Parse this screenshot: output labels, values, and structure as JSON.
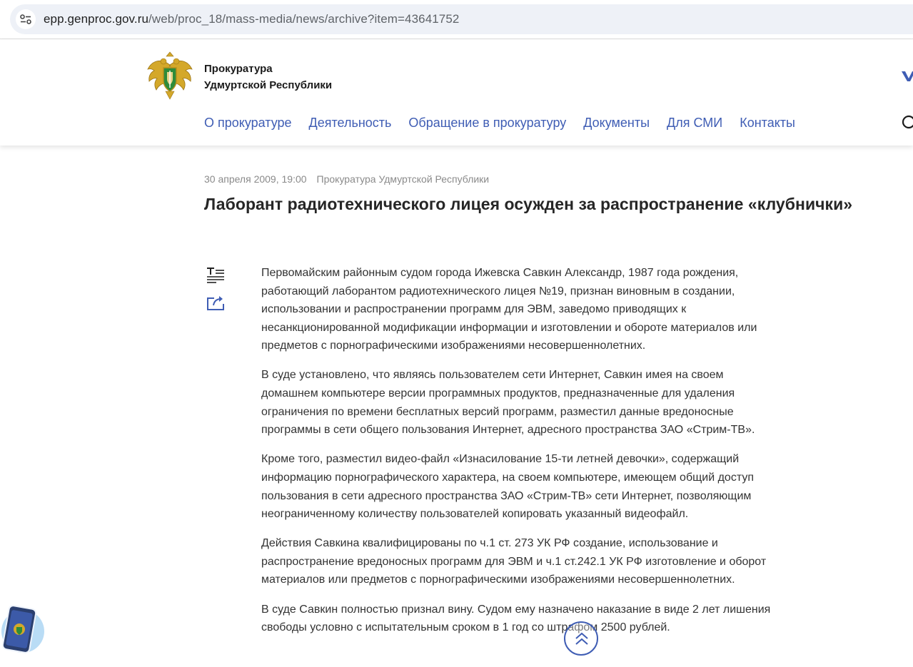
{
  "browser": {
    "url_host": "epp.genproc.gov.ru",
    "url_path": "/web/proc_18/mass-media/news/archive?item=43641752"
  },
  "header": {
    "org_line1": "Прокуратура",
    "org_line2": "Удмуртской Республики",
    "nav": [
      {
        "label": "О прокуратуре"
      },
      {
        "label": "Деятельность"
      },
      {
        "label": "Обращение в прокуратуру"
      },
      {
        "label": "Документы"
      },
      {
        "label": "Для СМИ"
      },
      {
        "label": "Контакты"
      }
    ]
  },
  "article": {
    "date": "30 апреля 2009, 19:00",
    "source": "Прокуратура Удмуртской Республики",
    "title": "Лаборант радиотехнического лицея осужден за распространение «клубнички»",
    "paragraphs": [
      "Первомайским районным судом города Ижевска Савкин Александр, 1987 года рождения, работающий лаборантом радиотехнического лицея №19, признан виновным в создании, использовании и распространении программ для ЭВМ, заведомо приводящих к несанкционированной модификации информации и изготовлении и обороте материалов или предметов с порнографическими изображениями несовершеннолетних.",
      "В суде установлено, что являясь пользователем сети Интернет, Савкин имея на своем домашнем компьютере версии программных продуктов, предназначенные для удаления ограничения по времени бесплатных версий программ, разместил данные вредоносные программы в сети общего пользования Интернет, адресного пространства ЗАО «Стрим-ТВ».",
      "Кроме того, разместил видео-файл «Изнасилование 15-ти летней девочки», содержащий информацию порнографического характера, на своем компьютере, имеющем общий доступ пользования в сети адресного пространства ЗАО «Стрим-ТВ» сети Интернет, позволяющим неограниченному количеству пользователей копировать указанный видеофайл.",
      "Действия Савкина квалифицированы по ч.1 ст. 273 УК РФ  создание, использование и распространение вредоносных программ для ЭВМ и ч.1 ст.242.1 УК РФ  изготовление и оборот материалов или предметов с порнографическими изображениями несовершеннолетних.",
      "В суде Савкин полностью признал вину. Судом ему назначено наказание в виде 2 лет лишения свободы условно с испытательным сроком в 1 год со штрафом 2500 рублей."
    ]
  },
  "icons": {
    "site_info": "tune-icon",
    "emblem": "prosecutor-emblem",
    "vk": "vk-icon",
    "search": "search-icon",
    "text_size": "text-size-icon",
    "share": "share-icon",
    "app": "mobile-app-icon",
    "scroll_top": "chevrons-up-icon"
  },
  "colors": {
    "nav_link": "#3f5db4",
    "title": "#262626",
    "body": "#333333",
    "meta": "#8a8a8a",
    "emblem_gold": "#d4a82a",
    "emblem_green": "#2e8b3a"
  }
}
